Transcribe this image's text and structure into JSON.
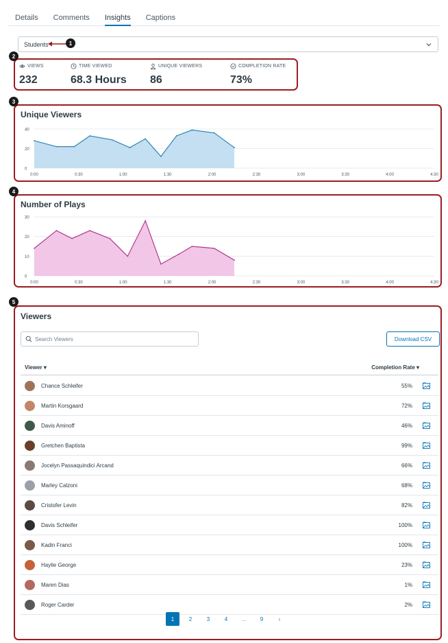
{
  "tabs": [
    "Details",
    "Comments",
    "Insights",
    "Captions"
  ],
  "filter": {
    "selected": "Students"
  },
  "markers": [
    "1",
    "2",
    "3",
    "4",
    "5"
  ],
  "stats": {
    "views": {
      "label": "VIEWS",
      "value": "232"
    },
    "time_viewed": {
      "label": "TIME VIEWED",
      "value": "68.3 Hours"
    },
    "unique_viewers": {
      "label": "UNIQUE VIEWERS",
      "value": "86"
    },
    "completion_rate": {
      "label": "COMPLETION RATE",
      "value": "73%"
    }
  },
  "chart_data": [
    {
      "type": "area",
      "title": "Unique Viewers",
      "x": [
        "0:00",
        "0:30",
        "1:00",
        "1:30",
        "2:00",
        "2:30",
        "3:00",
        "3:30",
        "4:00",
        "4:30"
      ],
      "points": [
        [
          0,
          28
        ],
        [
          0.5,
          22
        ],
        [
          0.9,
          22
        ],
        [
          1.25,
          33
        ],
        [
          1.75,
          29
        ],
        [
          2.15,
          21
        ],
        [
          2.5,
          30
        ],
        [
          2.85,
          12
        ],
        [
          3.2,
          33
        ],
        [
          3.55,
          39
        ],
        [
          4.05,
          36
        ],
        [
          4.5,
          21
        ]
      ],
      "ylim": [
        0,
        40
      ],
      "yticks": [
        0,
        20,
        40
      ],
      "color": "#2f84b3",
      "fill": "#bcdcef"
    },
    {
      "type": "area",
      "title": "Number of Plays",
      "x": [
        "0:00",
        "0:30",
        "1:00",
        "1:30",
        "2:00",
        "2:30",
        "3:00",
        "3:30",
        "4:00",
        "4:30"
      ],
      "points": [
        [
          0,
          14
        ],
        [
          0.5,
          23
        ],
        [
          0.85,
          19
        ],
        [
          1.25,
          23
        ],
        [
          1.7,
          19
        ],
        [
          2.1,
          10
        ],
        [
          2.5,
          28
        ],
        [
          2.85,
          6
        ],
        [
          3.25,
          11
        ],
        [
          3.55,
          15
        ],
        [
          4.05,
          14
        ],
        [
          4.5,
          8
        ]
      ],
      "ylim": [
        0,
        30
      ],
      "yticks": [
        0,
        10,
        20,
        30
      ],
      "color": "#b03a8e",
      "fill": "#efc0e3"
    }
  ],
  "viewers": {
    "title": "Viewers",
    "search_placeholder": "Search Viewers",
    "download_label": "Download CSV",
    "col_viewer": "Viewer ▾",
    "col_rate": "Completion Rate ▾",
    "rows": [
      {
        "name": "Chance Schleifer",
        "rate": "55%",
        "color": "#a07358"
      },
      {
        "name": "Martin Korsgaard",
        "rate": "72%",
        "color": "#c08866"
      },
      {
        "name": "Davis Aminoff",
        "rate": "46%",
        "color": "#3e5a4a"
      },
      {
        "name": "Gretchen Baptista",
        "rate": "99%",
        "color": "#6b3f2a"
      },
      {
        "name": "Jocelyn Passaquindici Arcand",
        "rate": "66%",
        "color": "#8a7a72"
      },
      {
        "name": "Marley Calzoni",
        "rate": "68%",
        "color": "#9aa0a8"
      },
      {
        "name": "Cristofer Levin",
        "rate": "82%",
        "color": "#5b4b44"
      },
      {
        "name": "Davis Schleifer",
        "rate": "100%",
        "color": "#2e2e2e"
      },
      {
        "name": "Kadin Franci",
        "rate": "100%",
        "color": "#7a5a48"
      },
      {
        "name": "Haylie George",
        "rate": "23%",
        "color": "#c4623a"
      },
      {
        "name": "Maren Dias",
        "rate": "1%",
        "color": "#b26a5c"
      },
      {
        "name": "Roger Carder",
        "rate": "2%",
        "color": "#595959"
      }
    ],
    "pages": [
      "1",
      "2",
      "3",
      "4",
      "...",
      "9",
      "›"
    ]
  },
  "colors": {
    "accent": "#0374b5",
    "callout": "#9b1c22"
  }
}
